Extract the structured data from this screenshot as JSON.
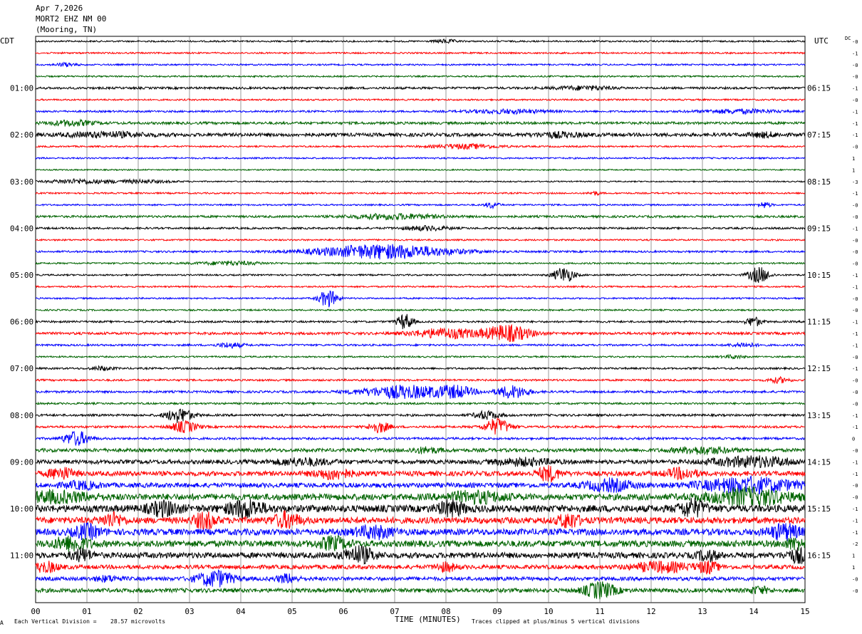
{
  "header": {
    "date": "Apr 7,2026",
    "station": "MORT2 EHZ NM 00",
    "location": "(Mooring, TN)"
  },
  "left_zone_label": "CDT",
  "right_zone_label": "UTC",
  "dc_label": "DC",
  "footer": {
    "xlabel": "TIME (MINUTES)",
    "scale_note_prefix": "Each Vertical Division =",
    "scale_value": "28.57 microvolts",
    "clip_note": "Traces clipped at plus/minus 5 vertical divisions",
    "corner_mark": "A"
  },
  "colors": {
    "trace_cycle": [
      "#000000",
      "#ff0000",
      "#0000ff",
      "#006400"
    ],
    "grid": "#555555",
    "background": "#ffffff"
  },
  "chart_data": {
    "type": "seismogram-helicorder",
    "x_ticks": [
      "00",
      "01",
      "02",
      "03",
      "04",
      "05",
      "06",
      "07",
      "08",
      "09",
      "10",
      "11",
      "12",
      "13",
      "14",
      "15"
    ],
    "xlim": [
      0,
      15
    ],
    "trace_count": 48,
    "trace_minutes": 15,
    "left_time_labels": [
      {
        "trace": 4,
        "label": "01:00"
      },
      {
        "trace": 8,
        "label": "02:00"
      },
      {
        "trace": 12,
        "label": "03:00"
      },
      {
        "trace": 16,
        "label": "04:00"
      },
      {
        "trace": 20,
        "label": "05:00"
      },
      {
        "trace": 24,
        "label": "06:00"
      },
      {
        "trace": 28,
        "label": "07:00"
      },
      {
        "trace": 32,
        "label": "08:00"
      },
      {
        "trace": 36,
        "label": "09:00"
      },
      {
        "trace": 40,
        "label": "10:00"
      },
      {
        "trace": 44,
        "label": "11:00"
      }
    ],
    "right_time_labels": [
      {
        "trace": 4,
        "label": "06:15"
      },
      {
        "trace": 8,
        "label": "07:15"
      },
      {
        "trace": 12,
        "label": "08:15"
      },
      {
        "trace": 16,
        "label": "09:15"
      },
      {
        "trace": 20,
        "label": "10:15"
      },
      {
        "trace": 24,
        "label": "11:15"
      },
      {
        "trace": 28,
        "label": "12:15"
      },
      {
        "trace": 32,
        "label": "13:15"
      },
      {
        "trace": 36,
        "label": "14:15"
      },
      {
        "trace": 40,
        "label": "15:15"
      },
      {
        "trace": 44,
        "label": "16:15"
      }
    ],
    "dc_offsets": [
      "-0",
      "-1",
      "-0",
      "-0",
      "-1",
      "-0",
      "-1",
      "-1",
      "-1",
      "-0",
      "1",
      "1",
      "-3",
      "-1",
      "-0",
      "-0",
      "-1",
      "-0",
      "-0",
      "-0",
      "-1",
      "-1",
      "-0",
      "-0",
      "-1",
      "-1",
      "-1",
      "-0",
      "-1",
      "-0",
      "-0",
      "-0",
      "-1",
      "-1",
      "0",
      "-0",
      "-1",
      "-1",
      "-0",
      "-0",
      "-1",
      "-1",
      "-1",
      "-2",
      "1",
      "1",
      "-0",
      "-0"
    ],
    "traces": [
      {
        "trace": 0,
        "noise": 0.5,
        "events": [
          {
            "min": 8.0,
            "amp": 1.1,
            "dur": 0.3
          }
        ]
      },
      {
        "trace": 1,
        "noise": 0.5,
        "events": []
      },
      {
        "trace": 2,
        "noise": 0.5,
        "events": [
          {
            "min": 0.6,
            "amp": 1.1,
            "dur": 0.3
          }
        ]
      },
      {
        "trace": 3,
        "noise": 0.5,
        "events": []
      },
      {
        "trace": 4,
        "noise": 0.7,
        "events": [
          {
            "min": 10.7,
            "amp": 1.1,
            "dur": 1.0
          }
        ]
      },
      {
        "trace": 5,
        "noise": 0.5,
        "events": []
      },
      {
        "trace": 6,
        "noise": 0.6,
        "events": [
          {
            "min": 9.2,
            "amp": 1.2,
            "dur": 1.4
          },
          {
            "min": 13.7,
            "amp": 1.2,
            "dur": 1.4
          }
        ]
      },
      {
        "trace": 7,
        "noise": 0.8,
        "events": [
          {
            "min": 0.7,
            "amp": 1.6,
            "dur": 0.8
          }
        ]
      },
      {
        "trace": 8,
        "noise": 1.1,
        "events": [
          {
            "min": 1.4,
            "amp": 1.4,
            "dur": 1.5
          },
          {
            "min": 10.2,
            "amp": 1.4,
            "dur": 0.8
          },
          {
            "min": 14.2,
            "amp": 1.3,
            "dur": 0.5
          }
        ]
      },
      {
        "trace": 9,
        "noise": 0.5,
        "events": [
          {
            "min": 8.4,
            "amp": 1.4,
            "dur": 1.2
          }
        ]
      },
      {
        "trace": 10,
        "noise": 0.5,
        "events": []
      },
      {
        "trace": 11,
        "noise": 0.4,
        "events": []
      },
      {
        "trace": 12,
        "noise": 0.4,
        "events": [
          {
            "min": 0.8,
            "amp": 1.4,
            "dur": 1.0
          },
          {
            "min": 2.0,
            "amp": 1.0,
            "dur": 1.2
          }
        ]
      },
      {
        "trace": 13,
        "noise": 0.5,
        "events": [
          {
            "min": 10.9,
            "amp": 1.2,
            "dur": 0.1
          }
        ]
      },
      {
        "trace": 14,
        "noise": 0.5,
        "events": [
          {
            "min": 8.9,
            "amp": 2.0,
            "dur": 0.15
          },
          {
            "min": 14.2,
            "amp": 1.8,
            "dur": 0.15
          }
        ]
      },
      {
        "trace": 15,
        "noise": 0.7,
        "events": [
          {
            "min": 7.0,
            "amp": 1.6,
            "dur": 1.6
          }
        ]
      },
      {
        "trace": 16,
        "noise": 0.6,
        "events": [
          {
            "min": 7.6,
            "amp": 1.3,
            "dur": 0.8
          }
        ]
      },
      {
        "trace": 17,
        "noise": 0.5,
        "events": []
      },
      {
        "trace": 18,
        "noise": 0.6,
        "events": [
          {
            "min": 6.8,
            "amp": 4.5,
            "dur": 2.5
          }
        ]
      },
      {
        "trace": 19,
        "noise": 0.5,
        "events": [
          {
            "min": 3.8,
            "amp": 1.1,
            "dur": 1.2
          }
        ]
      },
      {
        "trace": 20,
        "noise": 0.5,
        "events": [
          {
            "min": 10.3,
            "amp": 5.0,
            "dur": 0.3
          },
          {
            "min": 14.1,
            "amp": 5.0,
            "dur": 0.3
          }
        ]
      },
      {
        "trace": 21,
        "noise": 0.5,
        "events": []
      },
      {
        "trace": 22,
        "noise": 0.5,
        "events": [
          {
            "min": 5.7,
            "amp": 5.5,
            "dur": 0.25
          }
        ]
      },
      {
        "trace": 23,
        "noise": 0.5,
        "events": []
      },
      {
        "trace": 24,
        "noise": 0.6,
        "events": [
          {
            "min": 7.2,
            "amp": 5.0,
            "dur": 0.2
          },
          {
            "min": 14.0,
            "amp": 3.0,
            "dur": 0.2
          }
        ]
      },
      {
        "trace": 25,
        "noise": 0.8,
        "events": [
          {
            "min": 8.0,
            "amp": 3.0,
            "dur": 1.2
          },
          {
            "min": 9.2,
            "amp": 5.0,
            "dur": 0.8
          }
        ]
      },
      {
        "trace": 26,
        "noise": 0.6,
        "events": [
          {
            "min": 3.8,
            "amp": 1.5,
            "dur": 0.4
          },
          {
            "min": 13.8,
            "amp": 1.3,
            "dur": 0.4
          }
        ]
      },
      {
        "trace": 27,
        "noise": 0.5,
        "events": [
          {
            "min": 13.6,
            "amp": 1.0,
            "dur": 0.3
          }
        ]
      },
      {
        "trace": 28,
        "noise": 0.6,
        "events": [
          {
            "min": 1.3,
            "amp": 1.2,
            "dur": 0.3
          }
        ]
      },
      {
        "trace": 29,
        "noise": 0.6,
        "events": [
          {
            "min": 14.5,
            "amp": 1.6,
            "dur": 0.3
          }
        ]
      },
      {
        "trace": 30,
        "noise": 0.7,
        "events": [
          {
            "min": 7.2,
            "amp": 4.0,
            "dur": 1.6
          },
          {
            "min": 8.2,
            "amp": 3.0,
            "dur": 0.6
          },
          {
            "min": 9.3,
            "amp": 4.0,
            "dur": 0.5
          }
        ]
      },
      {
        "trace": 31,
        "noise": 0.6,
        "events": []
      },
      {
        "trace": 32,
        "noise": 0.7,
        "events": [
          {
            "min": 2.8,
            "amp": 4.5,
            "dur": 0.4
          },
          {
            "min": 8.8,
            "amp": 2.5,
            "dur": 0.4
          }
        ]
      },
      {
        "trace": 33,
        "noise": 0.7,
        "events": [
          {
            "min": 2.9,
            "amp": 3.5,
            "dur": 0.4
          },
          {
            "min": 6.7,
            "amp": 3.5,
            "dur": 0.3
          },
          {
            "min": 9.0,
            "amp": 5.0,
            "dur": 0.4
          }
        ]
      },
      {
        "trace": 34,
        "noise": 0.7,
        "events": [
          {
            "min": 0.8,
            "amp": 4.5,
            "dur": 0.4
          }
        ]
      },
      {
        "trace": 35,
        "noise": 1.1,
        "events": [
          {
            "min": 7.6,
            "amp": 1.6,
            "dur": 0.5
          },
          {
            "min": 13.0,
            "amp": 2.0,
            "dur": 1.0
          }
        ]
      },
      {
        "trace": 36,
        "noise": 1.3,
        "events": [
          {
            "min": 5.2,
            "amp": 2.0,
            "dur": 1.0
          },
          {
            "min": 9.5,
            "amp": 2.0,
            "dur": 1.0
          },
          {
            "min": 14.0,
            "amp": 3.0,
            "dur": 1.5
          }
        ]
      },
      {
        "trace": 37,
        "noise": 1.5,
        "events": [
          {
            "min": 0.5,
            "amp": 3.5,
            "dur": 0.4
          },
          {
            "min": 5.8,
            "amp": 3.0,
            "dur": 0.6
          },
          {
            "min": 10.0,
            "amp": 4.5,
            "dur": 0.3
          },
          {
            "min": 12.6,
            "amp": 3.0,
            "dur": 0.5
          }
        ]
      },
      {
        "trace": 38,
        "noise": 1.5,
        "events": [
          {
            "min": 0.9,
            "amp": 2.0,
            "dur": 0.6
          },
          {
            "min": 11.2,
            "amp": 3.5,
            "dur": 0.8
          },
          {
            "min": 13.9,
            "amp": 4.5,
            "dur": 1.8
          }
        ]
      },
      {
        "trace": 39,
        "noise": 2.0,
        "events": [
          {
            "min": 0.4,
            "amp": 3.0,
            "dur": 1.2
          },
          {
            "min": 8.6,
            "amp": 3.0,
            "dur": 1.0
          },
          {
            "min": 13.9,
            "amp": 5.0,
            "dur": 1.4
          }
        ]
      },
      {
        "trace": 40,
        "noise": 2.2,
        "events": [
          {
            "min": 2.5,
            "amp": 4.0,
            "dur": 0.5
          },
          {
            "min": 4.1,
            "amp": 5.0,
            "dur": 0.6
          },
          {
            "min": 8.1,
            "amp": 4.5,
            "dur": 0.4
          },
          {
            "min": 12.8,
            "amp": 5.0,
            "dur": 0.4
          }
        ]
      },
      {
        "trace": 41,
        "noise": 2.0,
        "events": [
          {
            "min": 1.5,
            "amp": 4.0,
            "dur": 0.3
          },
          {
            "min": 3.3,
            "amp": 5.0,
            "dur": 0.3
          },
          {
            "min": 4.9,
            "amp": 4.5,
            "dur": 0.4
          },
          {
            "min": 10.4,
            "amp": 4.5,
            "dur": 0.3
          }
        ]
      },
      {
        "trace": 42,
        "noise": 2.0,
        "events": [
          {
            "min": 1.0,
            "amp": 4.0,
            "dur": 0.4
          },
          {
            "min": 6.6,
            "amp": 3.5,
            "dur": 0.6
          },
          {
            "min": 14.6,
            "amp": 4.5,
            "dur": 0.5
          }
        ]
      },
      {
        "trace": 43,
        "noise": 2.0,
        "events": [
          {
            "min": 0.7,
            "amp": 4.0,
            "dur": 0.6
          },
          {
            "min": 5.8,
            "amp": 3.5,
            "dur": 0.5
          },
          {
            "min": 14.8,
            "amp": 3.0,
            "dur": 0.3
          }
        ]
      },
      {
        "trace": 44,
        "noise": 1.8,
        "events": [
          {
            "min": 0.9,
            "amp": 3.5,
            "dur": 0.3
          },
          {
            "min": 6.3,
            "amp": 5.0,
            "dur": 0.5
          },
          {
            "min": 13.1,
            "amp": 3.0,
            "dur": 0.3
          },
          {
            "min": 14.9,
            "amp": 4.0,
            "dur": 0.4
          }
        ]
      },
      {
        "trace": 45,
        "noise": 1.3,
        "events": [
          {
            "min": 0.2,
            "amp": 3.0,
            "dur": 0.4
          },
          {
            "min": 8.0,
            "amp": 2.5,
            "dur": 0.3
          },
          {
            "min": 12.2,
            "amp": 3.0,
            "dur": 1.0
          },
          {
            "min": 13.1,
            "amp": 3.5,
            "dur": 0.3
          }
        ]
      },
      {
        "trace": 46,
        "noise": 1.2,
        "events": [
          {
            "min": 1.4,
            "amp": 1.5,
            "dur": 0.4
          },
          {
            "min": 3.5,
            "amp": 5.0,
            "dur": 0.6
          },
          {
            "min": 4.9,
            "amp": 2.5,
            "dur": 0.3
          }
        ]
      },
      {
        "trace": 47,
        "noise": 1.3,
        "events": [
          {
            "min": 11.0,
            "amp": 5.0,
            "dur": 0.5
          },
          {
            "min": 14.1,
            "amp": 2.0,
            "dur": 0.3
          }
        ]
      }
    ]
  }
}
